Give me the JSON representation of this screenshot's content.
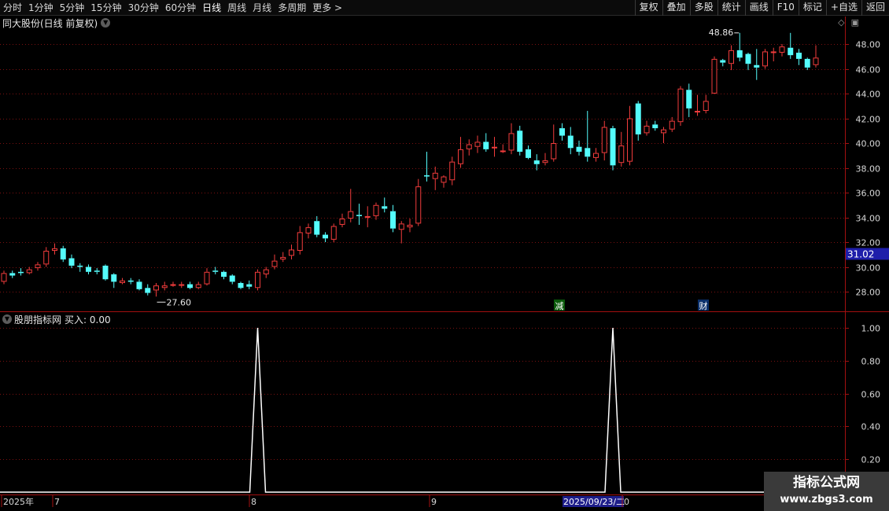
{
  "toolbar": {
    "periods": [
      "分时",
      "1分钟",
      "5分钟",
      "15分钟",
      "30分钟",
      "60分钟",
      "日线",
      "周线",
      "月线",
      "多周期",
      "更多 >"
    ],
    "active": "日线",
    "actions": [
      "复权",
      "叠加",
      "多股",
      "统计",
      "画线",
      "F10",
      "标记",
      "+自选",
      "返回"
    ]
  },
  "main_panel": {
    "title": "同大股份(日线 前复权)",
    "current_price_label": "31.02",
    "high_label": "48.86",
    "low_label": "27.60",
    "markers": [
      "减",
      "财"
    ]
  },
  "indicator_panel": {
    "title": "股朋指标网",
    "value_text": "买入: 0.00"
  },
  "time_axis": {
    "labels": [
      "2025年",
      "7",
      "8",
      "9",
      "2025/09/23/二",
      "0"
    ]
  },
  "watermark": {
    "line1": "指标公式网",
    "line2": "www.zbgs3.com"
  },
  "colors": {
    "up": "#f23c3c",
    "down": "#54fcfc",
    "grid": "#7a1111",
    "axis_text": "#d8d8d8",
    "price_tag_bg": "#1e1eaa",
    "signal_line": "#ffffff"
  },
  "chart_data": [
    {
      "type": "candlestick",
      "title": "同大股份(日线 前复权)",
      "ylim": [
        27,
        50
      ],
      "yticks": [
        28,
        30,
        32,
        34,
        36,
        38,
        40,
        42,
        44,
        46,
        48
      ],
      "candles": [
        [
          28.8,
          29.5,
          29.7,
          28.6
        ],
        [
          29.5,
          29.3,
          29.7,
          29.1
        ],
        [
          29.6,
          29.5,
          29.9,
          29.3
        ],
        [
          29.5,
          29.8,
          30.0,
          29.4
        ],
        [
          29.9,
          30.2,
          30.4,
          29.7
        ],
        [
          30.2,
          31.3,
          31.6,
          30.0
        ],
        [
          31.3,
          31.5,
          31.9,
          31.0
        ],
        [
          31.5,
          30.6,
          31.7,
          30.4
        ],
        [
          30.7,
          30.1,
          31.0,
          29.9
        ],
        [
          30.1,
          30.0,
          30.3,
          29.6
        ],
        [
          30.0,
          29.6,
          30.2,
          29.4
        ],
        [
          29.7,
          29.6,
          29.9,
          29.4
        ],
        [
          30.1,
          29.0,
          30.2,
          28.9
        ],
        [
          29.4,
          28.8,
          29.5,
          28.3
        ],
        [
          28.7,
          28.9,
          29.1,
          28.6
        ],
        [
          28.9,
          28.8,
          29.1,
          28.6
        ],
        [
          28.8,
          28.2,
          29.0,
          28.1
        ],
        [
          28.3,
          27.9,
          28.6,
          27.7
        ],
        [
          28.1,
          28.5,
          28.7,
          27.6
        ],
        [
          28.3,
          28.5,
          28.8,
          28.1
        ],
        [
          28.6,
          28.6,
          28.8,
          28.4
        ],
        [
          28.5,
          28.6,
          28.8,
          28.3
        ],
        [
          28.6,
          28.3,
          28.8,
          28.2
        ],
        [
          28.3,
          28.6,
          28.8,
          28.2
        ],
        [
          28.6,
          29.6,
          29.9,
          28.5
        ],
        [
          29.7,
          29.6,
          30.0,
          29.4
        ],
        [
          29.6,
          29.2,
          29.7,
          29.0
        ],
        [
          29.3,
          28.8,
          29.4,
          28.6
        ],
        [
          28.7,
          28.3,
          28.8,
          28.2
        ],
        [
          28.6,
          28.4,
          28.9,
          28.2
        ],
        [
          28.3,
          29.6,
          29.8,
          28.1
        ],
        [
          29.4,
          29.8,
          30.0,
          29.1
        ],
        [
          30.0,
          30.5,
          31.0,
          29.8
        ],
        [
          30.6,
          30.8,
          31.2,
          30.4
        ],
        [
          30.9,
          31.4,
          31.8,
          30.6
        ],
        [
          31.3,
          32.8,
          33.3,
          31.0
        ],
        [
          32.7,
          33.2,
          33.5,
          32.3
        ],
        [
          33.7,
          32.6,
          34.1,
          32.4
        ],
        [
          32.6,
          32.3,
          32.8,
          32.0
        ],
        [
          32.2,
          33.3,
          33.5,
          32.0
        ],
        [
          33.4,
          33.9,
          34.3,
          33.2
        ],
        [
          33.9,
          34.5,
          36.3,
          33.6
        ],
        [
          34.2,
          34.1,
          35.1,
          33.4
        ],
        [
          34.0,
          34.1,
          34.9,
          33.2
        ],
        [
          34.1,
          35.0,
          35.2,
          33.8
        ],
        [
          34.9,
          34.7,
          35.6,
          34.4
        ],
        [
          34.5,
          33.1,
          35.0,
          32.8
        ],
        [
          33.0,
          33.5,
          33.7,
          31.9
        ],
        [
          33.2,
          33.4,
          33.9,
          32.8
        ],
        [
          33.5,
          36.5,
          37.1,
          33.3
        ],
        [
          37.4,
          37.3,
          39.3,
          36.9
        ],
        [
          37.1,
          37.6,
          38.1,
          36.2
        ],
        [
          36.8,
          37.3,
          37.4,
          36.4
        ],
        [
          37.0,
          38.5,
          38.9,
          36.6
        ],
        [
          38.3,
          39.5,
          40.5,
          38.0
        ],
        [
          39.5,
          39.9,
          40.3,
          39.0
        ],
        [
          39.7,
          40.1,
          40.6,
          39.2
        ],
        [
          40.1,
          39.5,
          40.8,
          39.3
        ],
        [
          39.6,
          39.7,
          40.5,
          38.9
        ],
        [
          39.4,
          39.4,
          39.9,
          39.2
        ],
        [
          39.4,
          40.8,
          41.6,
          39.1
        ],
        [
          41.0,
          39.3,
          41.4,
          39.0
        ],
        [
          39.5,
          38.8,
          39.8,
          38.7
        ],
        [
          38.6,
          38.3,
          39.1,
          37.8
        ],
        [
          38.4,
          38.6,
          39.2,
          38.2
        ],
        [
          38.7,
          40.0,
          41.5,
          38.5
        ],
        [
          41.2,
          40.6,
          41.6,
          40.2
        ],
        [
          40.6,
          39.6,
          41.3,
          39.1
        ],
        [
          39.7,
          39.3,
          40.2,
          39.0
        ],
        [
          39.6,
          38.9,
          42.6,
          38.5
        ],
        [
          38.8,
          39.2,
          39.6,
          38.5
        ],
        [
          39.2,
          41.3,
          41.8,
          38.6
        ],
        [
          41.2,
          38.2,
          41.4,
          37.8
        ],
        [
          38.4,
          39.8,
          40.9,
          38.1
        ],
        [
          38.5,
          42.0,
          43.0,
          38.2
        ],
        [
          43.2,
          40.7,
          43.4,
          40.2
        ],
        [
          40.8,
          41.4,
          41.8,
          40.6
        ],
        [
          41.5,
          41.2,
          41.8,
          41.0
        ],
        [
          40.8,
          41.1,
          41.3,
          40.0
        ],
        [
          41.1,
          41.8,
          42.1,
          40.9
        ],
        [
          41.7,
          44.4,
          44.6,
          41.4
        ],
        [
          44.3,
          42.8,
          44.8,
          42.1
        ],
        [
          42.6,
          42.6,
          43.9,
          42.2
        ],
        [
          42.6,
          43.4,
          43.9,
          42.4
        ],
        [
          44.0,
          46.8,
          47.0,
          44.0
        ],
        [
          46.7,
          46.5,
          46.8,
          46.2
        ],
        [
          46.4,
          47.5,
          47.9,
          45.9
        ],
        [
          47.5,
          46.9,
          48.9,
          46.6
        ],
        [
          47.2,
          46.4,
          47.3,
          45.9
        ],
        [
          46.3,
          46.1,
          47.6,
          45.1
        ],
        [
          46.2,
          47.4,
          47.6,
          46.0
        ],
        [
          47.3,
          47.4,
          47.7,
          46.6
        ],
        [
          47.3,
          47.8,
          48.0,
          47.0
        ],
        [
          47.7,
          47.1,
          48.9,
          46.8
        ],
        [
          47.3,
          46.8,
          47.6,
          46.3
        ],
        [
          46.8,
          46.1,
          46.9,
          45.9
        ],
        [
          46.3,
          46.9,
          47.9,
          46.1
        ]
      ]
    },
    {
      "type": "line",
      "title": "股朋指标网",
      "series": [
        {
          "name": "买入",
          "pulses": [
            {
              "index": 30,
              "value": 1.0
            },
            {
              "index": 72,
              "value": 1.0
            }
          ]
        }
      ],
      "ylim": [
        0,
        1.08
      ],
      "yticks": [
        0.2,
        0.4,
        0.6,
        0.8,
        1.0
      ]
    }
  ]
}
